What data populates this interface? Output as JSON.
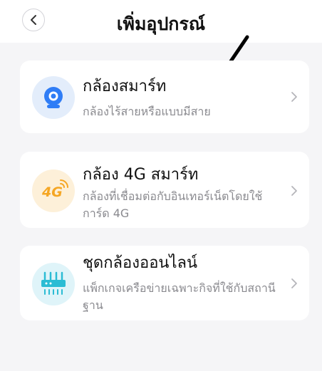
{
  "header": {
    "title": "เพิ่มอุปกรณ์"
  },
  "devices": [
    {
      "title": "กล้องสมาร์ท",
      "desc": "กล้องไร้สายหรือแบบมีสาย",
      "icon": "camera-icon"
    },
    {
      "title": "กล้อง 4G สมาร์ท",
      "desc": "กล้องที่เชื่อมต่อกับอินเทอร์เน็ตโดยใช้การ์ด 4G",
      "icon": "4g-icon",
      "icon_text": "4G"
    },
    {
      "title": "ชุดกล้องออนไลน์",
      "desc": "แพ็กเกจเครือข่ายเฉพาะกิจที่ใช้กับสถานีฐาน",
      "icon": "router-icon"
    }
  ],
  "colors": {
    "camera_accent": "#2f7df6",
    "g4_accent": "#f5a623",
    "router_accent": "#2bbcd4"
  }
}
